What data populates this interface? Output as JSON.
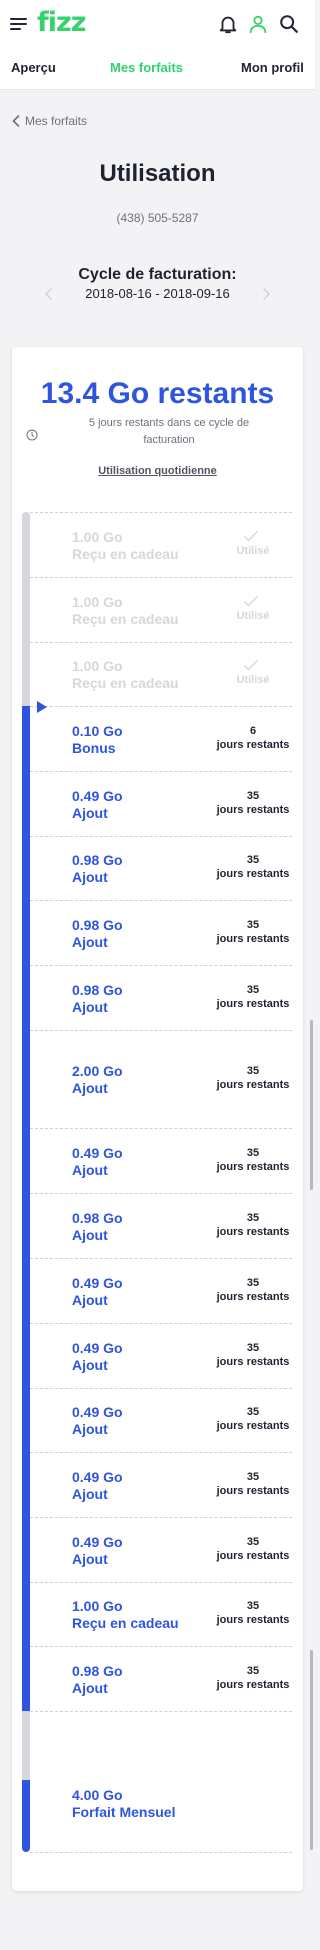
{
  "header": {
    "logo": "fizz",
    "icons": [
      "menu-icon",
      "bell-icon",
      "user-icon",
      "search-icon"
    ],
    "colors": {
      "brand": "#36d36c",
      "accent": "#2e54e0"
    }
  },
  "nav": {
    "tabs": [
      {
        "label": "Aperçu",
        "active": false
      },
      {
        "label": "Mes forfaits",
        "active": true
      },
      {
        "label": "Mon profil",
        "active": false
      }
    ]
  },
  "page": {
    "back_label": "Mes forfaits",
    "title": "Utilisation",
    "phone": "(438) 505-5287",
    "cycle_label": "Cycle de facturation:",
    "cycle_range": "2018-08-16 - 2018-09-16"
  },
  "usage": {
    "remaining": "13.4 Go restants",
    "days_left": "5 jours restants dans ce cycle de facturation",
    "daily_link": "Utilisation quotidienne",
    "items": [
      {
        "amount": "1.00 Go",
        "type": "Reçu en cadeau",
        "status_top": "",
        "status_bottom": "Utilisé",
        "used": true
      },
      {
        "amount": "1.00 Go",
        "type": "Reçu en cadeau",
        "status_top": "",
        "status_bottom": "Utilisé",
        "used": true
      },
      {
        "amount": "1.00 Go",
        "type": "Reçu en cadeau",
        "status_top": "",
        "status_bottom": "Utilisé",
        "used": true
      },
      {
        "amount": "0.10 Go",
        "type": "Bonus",
        "status_top": "6",
        "status_bottom": "jours restants",
        "used": false
      },
      {
        "amount": "0.49 Go",
        "type": "Ajout",
        "status_top": "35",
        "status_bottom": "jours restants",
        "used": false
      },
      {
        "amount": "0.98 Go",
        "type": "Ajout",
        "status_top": "35",
        "status_bottom": "jours restants",
        "used": false
      },
      {
        "amount": "0.98 Go",
        "type": "Ajout",
        "status_top": "35",
        "status_bottom": "jours restants",
        "used": false
      },
      {
        "amount": "0.98 Go",
        "type": "Ajout",
        "status_top": "35",
        "status_bottom": "jours restants",
        "used": false
      },
      {
        "amount": "2.00 Go",
        "type": "Ajout",
        "status_top": "35",
        "status_bottom": "jours restants",
        "used": false
      },
      {
        "amount": "0.49 Go",
        "type": "Ajout",
        "status_top": "35",
        "status_bottom": "jours restants",
        "used": false
      },
      {
        "amount": "0.98 Go",
        "type": "Ajout",
        "status_top": "35",
        "status_bottom": "jours restants",
        "used": false
      },
      {
        "amount": "0.49 Go",
        "type": "Ajout",
        "status_top": "35",
        "status_bottom": "jours restants",
        "used": false
      },
      {
        "amount": "0.49 Go",
        "type": "Ajout",
        "status_top": "35",
        "status_bottom": "jours restants",
        "used": false
      },
      {
        "amount": "0.49 Go",
        "type": "Ajout",
        "status_top": "35",
        "status_bottom": "jours restants",
        "used": false
      },
      {
        "amount": "0.49 Go",
        "type": "Ajout",
        "status_top": "35",
        "status_bottom": "jours restants",
        "used": false
      },
      {
        "amount": "0.49 Go",
        "type": "Ajout",
        "status_top": "35",
        "status_bottom": "jours restants",
        "used": false
      },
      {
        "amount": "1.00 Go",
        "type": "Reçu en cadeau",
        "status_top": "35",
        "status_bottom": "jours restants",
        "used": false
      },
      {
        "amount": "0.98 Go",
        "type": "Ajout",
        "status_top": "35",
        "status_bottom": "jours restants",
        "used": false
      },
      {
        "amount": "4.00 Go",
        "type": "Forfait Mensuel",
        "status_top": "",
        "status_bottom": "",
        "used": false
      }
    ]
  }
}
